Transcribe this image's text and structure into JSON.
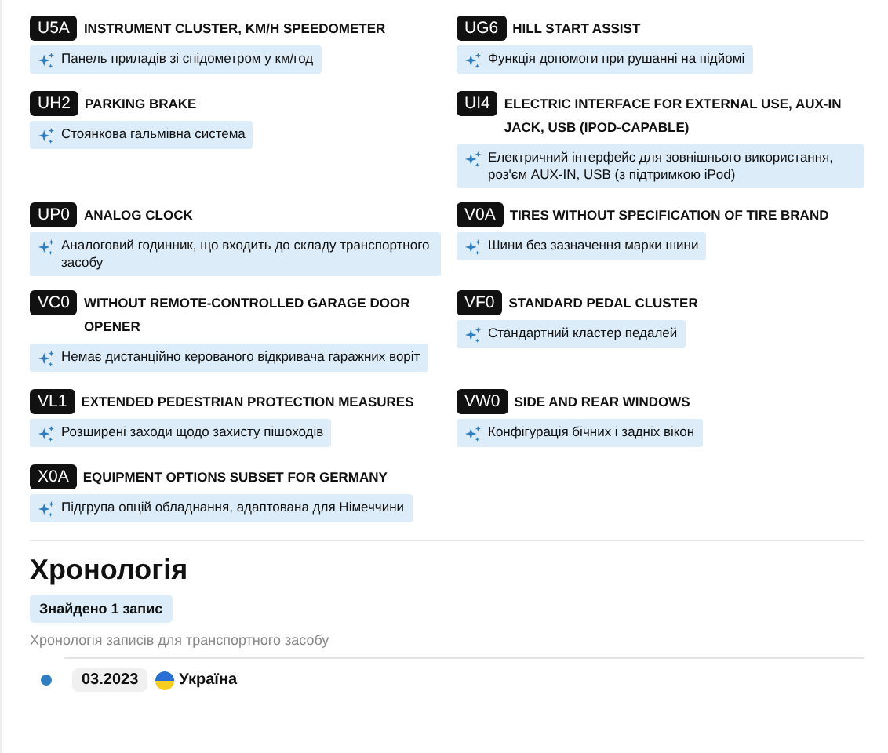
{
  "options": [
    {
      "code": "U5A",
      "title": "INSTRUMENT CLUSTER, KM/H SPEEDOMETER",
      "description": "Панель приладів зі спідометром у км/год"
    },
    {
      "code": "UG6",
      "title": "HILL START ASSIST",
      "description": "Функція допомоги при рушанні на підйомі"
    },
    {
      "code": "UH2",
      "title": "PARKING BRAKE",
      "description": "Стоянкова гальмівна система"
    },
    {
      "code": "UI4",
      "title": "ELECTRIC INTERFACE FOR EXTERNAL USE, AUX-IN JACK, USB (IPOD-CAPABLE)",
      "description": "Електричний інтерфейс для зовнішнього використання, роз'єм AUX-IN, USB (з підтримкою iPod)"
    },
    {
      "code": "UP0",
      "title": "ANALOG CLOCK",
      "description": "Аналоговий годинник, що входить до складу транспортного засобу"
    },
    {
      "code": "V0A",
      "title": "TIRES WITHOUT SPECIFICATION OF TIRE BRAND",
      "description": "Шини без зазначення марки шини"
    },
    {
      "code": "VC0",
      "title": "WITHOUT REMOTE-CONTROLLED GARAGE DOOR OPENER",
      "description": "Немає дистанційно керованого відкривача гаражних воріт"
    },
    {
      "code": "VF0",
      "title": "STANDARD PEDAL CLUSTER",
      "description": "Стандартний кластер педалей"
    },
    {
      "code": "VL1",
      "title": "EXTENDED PEDESTRIAN PROTECTION MEASURES",
      "description": "Розширені заходи щодо захисту пішоходів"
    },
    {
      "code": "VW0",
      "title": "SIDE AND REAR WINDOWS",
      "description": "Конфігурація бічних і задніх вікон"
    },
    {
      "code": "X0A",
      "title": "EQUIPMENT OPTIONS SUBSET FOR GERMANY",
      "description": "Підгрупа опцій обладнання, адаптована для Німеччини"
    }
  ],
  "timeline": {
    "heading": "Хронологія",
    "badge": "Знайдено 1 запис",
    "subtitle": "Хронологія записів для транспортного засобу",
    "entries": [
      {
        "date": "03.2023",
        "country": "Україна"
      }
    ]
  }
}
